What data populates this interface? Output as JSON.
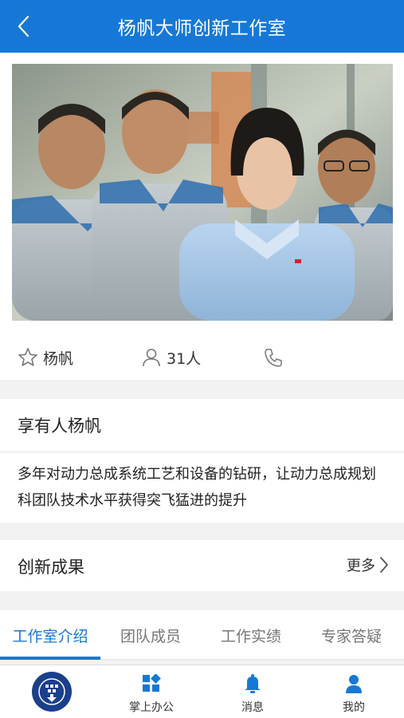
{
  "header": {
    "title": "杨帆大师创新工作室",
    "back_icon": "chevron-left-icon"
  },
  "photo": {
    "description_icon": "team-photo-image"
  },
  "info": {
    "leader_name": "杨帆",
    "member_count": "31人",
    "star_icon": "star-outline-icon",
    "person_icon": "person-icon",
    "phone_icon": "phone-icon"
  },
  "owner": {
    "title": "享有人杨帆",
    "description": "多年对动力总成系统工艺和设备的钻研，让动力总成规划科团队技术水平获得突飞猛进的提升"
  },
  "results": {
    "title": "创新成果",
    "more_label": "更多"
  },
  "tabs": [
    {
      "label": "工作室介绍",
      "active": true
    },
    {
      "label": "团队成员",
      "active": false
    },
    {
      "label": "工作实绩",
      "active": false
    },
    {
      "label": "专家答疑",
      "active": false
    }
  ],
  "bottom_nav": [
    {
      "label": "",
      "icon": "logo-icon"
    },
    {
      "label": "掌上办公",
      "icon": "grid-icon"
    },
    {
      "label": "消息",
      "icon": "bell-icon"
    },
    {
      "label": "我的",
      "icon": "user-icon"
    }
  ],
  "colors": {
    "primary": "#1678d6",
    "logo_bg": "#1a3f8c",
    "background": "#f2f2f2"
  }
}
